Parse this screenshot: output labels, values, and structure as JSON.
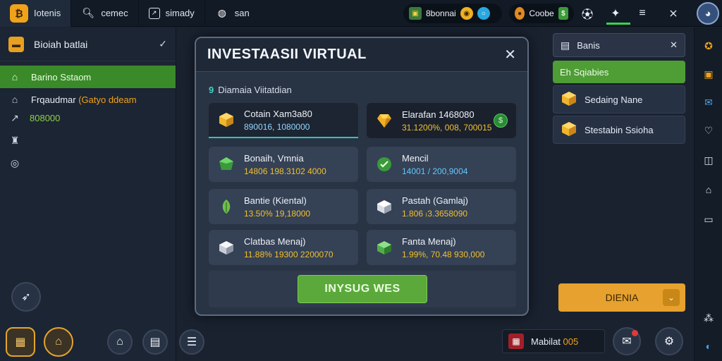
{
  "top_bar": {
    "brand_label": "Iotenis",
    "tabs": [
      {
        "label": "cemec",
        "icon": "search-icon"
      },
      {
        "label": "simady",
        "icon": "chart-icon"
      },
      {
        "label": "san",
        "icon": "globe-icon"
      }
    ],
    "resource_a_label": "8bonnai",
    "resource_b_label": "Coobe"
  },
  "left_sidebar": {
    "header_label": "Bioiah batlai",
    "items": [
      {
        "label": "Barino Sstaom",
        "icon": "home-icon",
        "active": true
      },
      {
        "label": "Frqaudmar",
        "extra": "(Gatyo ddeam",
        "icon": "bookmark-icon"
      },
      {
        "label": "",
        "value": "808000",
        "icon": "up-arrow-icon"
      },
      {
        "label": "",
        "icon": "trophy-icon"
      },
      {
        "label": "",
        "icon": "target-icon"
      }
    ]
  },
  "modal": {
    "title": "INVESTAASII VIRTUAL",
    "subtitle_prefix": "9",
    "subtitle": "Diamaia Viitatdian",
    "cards": [
      {
        "name": "Cotain Xam3a80",
        "values": "890016, 1080000",
        "value_color": "#8fd6ff",
        "icon": "gold-cube-icon",
        "style": "highlight"
      },
      {
        "name": "Elarafan 1468080",
        "values": "31.1200%, 008, 700015",
        "value_color": "#f0c030",
        "icon": "gold-gem-icon",
        "style": "dark"
      },
      {
        "name": "Bonaih, Vmnia",
        "values": "14806 198.3102 4000",
        "value_color": "#f0c030",
        "extra": "4000",
        "icon": "green-gem-icon"
      },
      {
        "name": "Mencil",
        "values": "14001 / 200,9004",
        "value_color": "#63c7ff",
        "icon": "green-check-icon"
      },
      {
        "name": "Bantie (Kiental)",
        "values": "13.50% 19,18000",
        "value_color": "#f0c030",
        "icon": "leaf-icon"
      },
      {
        "name": "Pastah (Gamlaj)",
        "values": "1.806 ₍3.3658090",
        "value_color": "#f0c030",
        "icon": "white-cube-icon"
      },
      {
        "name": "Clatbas Menaj)",
        "values": "11.88% 19300 2200070",
        "value_color": "#f0c030",
        "icon": "silver-cube-icon"
      },
      {
        "name": "Fanta Menaj)",
        "values": "1.99%, 70.48 930,000",
        "value_color": "#f0c030",
        "icon": "emerald-cube-icon"
      }
    ],
    "invest_button": "INYSUG WES"
  },
  "right_panel": {
    "top_label": "Banis",
    "green_label": "Eh Sqiabies",
    "items": [
      {
        "label": "Sedaing Nane",
        "icon": "gold-cube-icon"
      },
      {
        "label": "Stestabin Ssioha",
        "icon": "gold-cube-icon"
      }
    ],
    "orange_button": "DIENIA"
  },
  "status_pill": {
    "label": "Mabilat",
    "value": "005"
  }
}
